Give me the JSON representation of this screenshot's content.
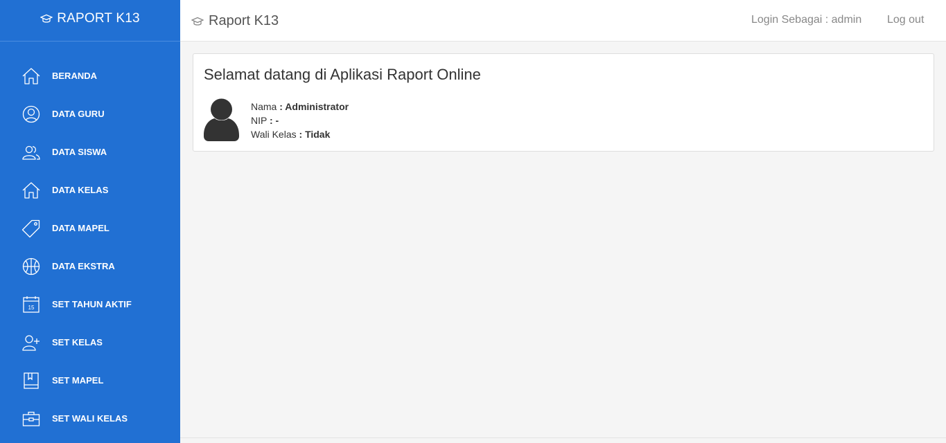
{
  "sidebar": {
    "brand": "RAPORT K13",
    "items": [
      {
        "label": "BERANDA",
        "icon": "home-icon"
      },
      {
        "label": "DATA GURU",
        "icon": "user-circle-icon"
      },
      {
        "label": "DATA SISWA",
        "icon": "users-icon"
      },
      {
        "label": "DATA KELAS",
        "icon": "home-icon"
      },
      {
        "label": "DATA MAPEL",
        "icon": "tag-icon"
      },
      {
        "label": "DATA EKSTRA",
        "icon": "basketball-icon"
      },
      {
        "label": "SET TAHUN AKTIF",
        "icon": "calendar-icon"
      },
      {
        "label": "SET KELAS",
        "icon": "user-add-icon"
      },
      {
        "label": "SET MAPEL",
        "icon": "book-icon"
      },
      {
        "label": "SET WALI KELAS",
        "icon": "briefcase-icon"
      }
    ]
  },
  "topbar": {
    "title": "Raport K13",
    "login_text": "Login Sebagai : admin",
    "logout_label": "Log out"
  },
  "panel": {
    "title": "Selamat datang di Aplikasi Raport Online",
    "fields": [
      {
        "label": "Nama",
        "value": ": Administrator"
      },
      {
        "label": "NIP",
        "value": ": -"
      },
      {
        "label": "Wali Kelas",
        "value": ": Tidak"
      }
    ]
  },
  "calendar_icon_text": "15",
  "colors": {
    "sidebar": "#2170d3",
    "background": "#f5f5f5"
  }
}
